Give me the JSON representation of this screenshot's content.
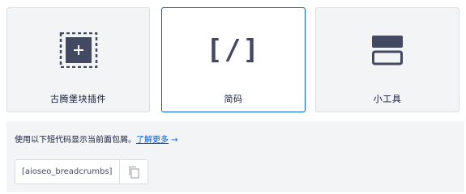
{
  "cards": [
    {
      "label": "古腾堡块插件",
      "icon": "gutenberg-block-icon",
      "active": false
    },
    {
      "label": "简码",
      "icon": "shortcode-icon",
      "glyph": "[/]",
      "active": true
    },
    {
      "label": "小工具",
      "icon": "widget-icon",
      "active": false
    }
  ],
  "info": {
    "text": "使用以下短代码显示当前面包屑。",
    "link": "了解更多",
    "arrow": "→"
  },
  "shortcode": {
    "value": "[aioseo_breadcrumbs]",
    "copy_icon": "copy-icon"
  },
  "colors": {
    "accent": "#005ae0",
    "icon": "#434960",
    "text": "#141b38",
    "panel_bg": "#f3f4f5",
    "border": "#dcdde1"
  }
}
